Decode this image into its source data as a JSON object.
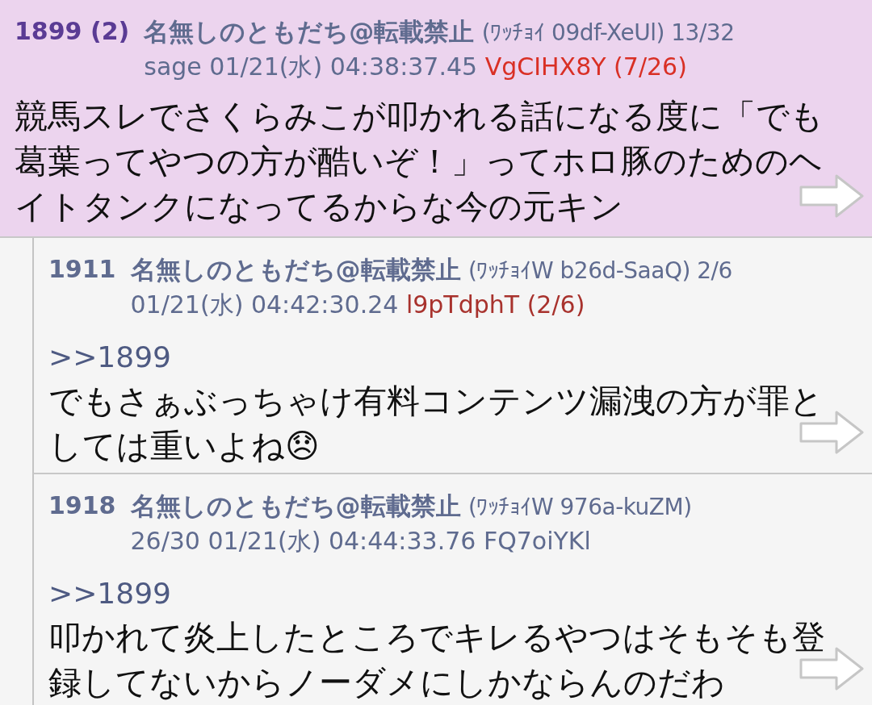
{
  "posts": [
    {
      "number": "1899",
      "replies": "(2)",
      "selected": true,
      "name": "名無しのともだち@転載禁止",
      "info": "(ﾜｯﾁｮｲ 09df-XeUl) 13/32",
      "meta": "sage 01/21(水) 04:38:37.45",
      "id": "VgCIHX8Y (7/26)",
      "color": "#d93025",
      "body": [
        "競馬スレでさくらみこが叩かれる話になる度に「でも",
        "葛葉ってやつの方が酷いぞ！」ってホロ豚のためのヘ",
        "イトタンクになってるからな今の元キン"
      ]
    },
    {
      "number": "1911",
      "selected": false,
      "name": "名無しのともだち@転載禁止",
      "info": "(ﾜｯﾁｮｲW b26d-SaaQ) 2/6",
      "meta": "01/21(水) 04:42:30.24",
      "id": "l9pTdphT (2/6)",
      "color": "#a8322d",
      "anchor": ">>1899",
      "body": [
        "でもさぁぶっちゃけ有料コンテンツ漏洩の方が罪と",
        "しては重いよね😞"
      ]
    },
    {
      "number": "1918",
      "selected": false,
      "name": "名無しのともだち@転載禁止",
      "info": "(ﾜｯﾁｮｲW 976a-kuZM)",
      "meta": "26/30  01/21(水) 04:44:33.76",
      "id": "FQ7oiYKl",
      "color": "#5f6b8f",
      "anchor": ">>1899",
      "body": [
        "叩かれて炎上したところでキレるやつはそもそも登",
        "録してないからノーダメにしかならんのだわ"
      ]
    }
  ]
}
